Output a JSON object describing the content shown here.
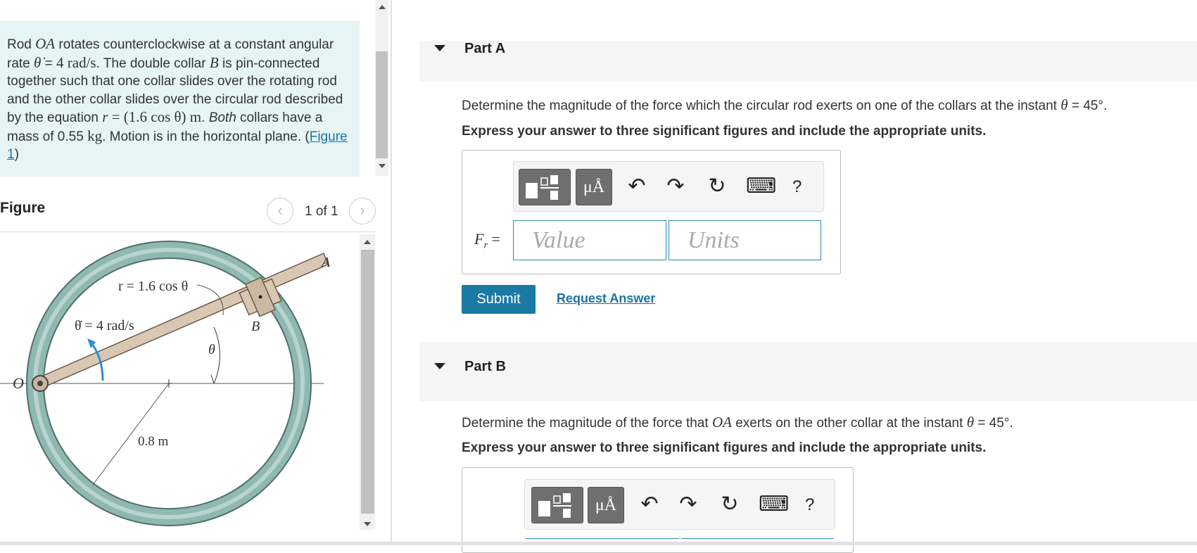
{
  "problem": {
    "t1": "Rod ",
    "oa": "OA",
    "t2": " rotates counterclockwise at a constant angular rate ",
    "thetadot": "θ̇",
    "t3": " = ",
    "rate": "4 rad/s",
    "t4": ". The double collar ",
    "b": "B",
    "t5": " is pin-connected together such that one collar slides over the rotating rod and the other collar slides over the circular rod described by the equation ",
    "r": "r",
    "eq": " = (1.6 cos θ) m",
    "t6": ". ",
    "both": "Both",
    "t7": " collars have a mass of 0.55 ",
    "kg": "kg",
    "t8": ". Motion is in the horizontal plane. (",
    "figure_link": "Figure 1",
    "t9": ")"
  },
  "figure": {
    "title": "Figure",
    "pager": "1 of 1",
    "prev": "‹",
    "next": "›",
    "label_A": "A",
    "label_B": "B",
    "label_O": "O",
    "label_r": "r = 1.6 cos θ",
    "label_thetadot": "θ̇ = 4 rad/s",
    "label_theta": "θ",
    "label_radius": "0.8 m"
  },
  "partA": {
    "title": "Part A",
    "q1": "Determine the magnitude of the force which the circular rod exerts on one of the collars at the instant ",
    "q_theta": "θ",
    "q2": " = 45°.",
    "instruction": "Express your answer to three significant figures and include the appropriate units.",
    "unit_btn": "μÅ",
    "undo": "↶",
    "redo": "↷",
    "reset": "↻",
    "keyboard": "⌨",
    "help": "?",
    "label_F": "F",
    "label_sub": "r",
    "label_eq": " =",
    "value_placeholder": "Value",
    "units_placeholder": "Units",
    "submit": "Submit",
    "request": "Request Answer"
  },
  "partB": {
    "title": "Part B",
    "q1": "Determine the magnitude of the force that ",
    "q_oa": "OA",
    "q2": " exerts on the other collar at the instant ",
    "q_theta": "θ",
    "q3": " = 45°.",
    "instruction": "Express your answer to three significant figures and include the appropriate units.",
    "unit_btn": "μÅ",
    "undo": "↶",
    "redo": "↷",
    "reset": "↻",
    "keyboard": "⌨",
    "help": "?"
  },
  "colors": {
    "accent": "#1a7aa3",
    "problem_bg": "#e6f4f4",
    "ring": "#8fb8b0"
  }
}
